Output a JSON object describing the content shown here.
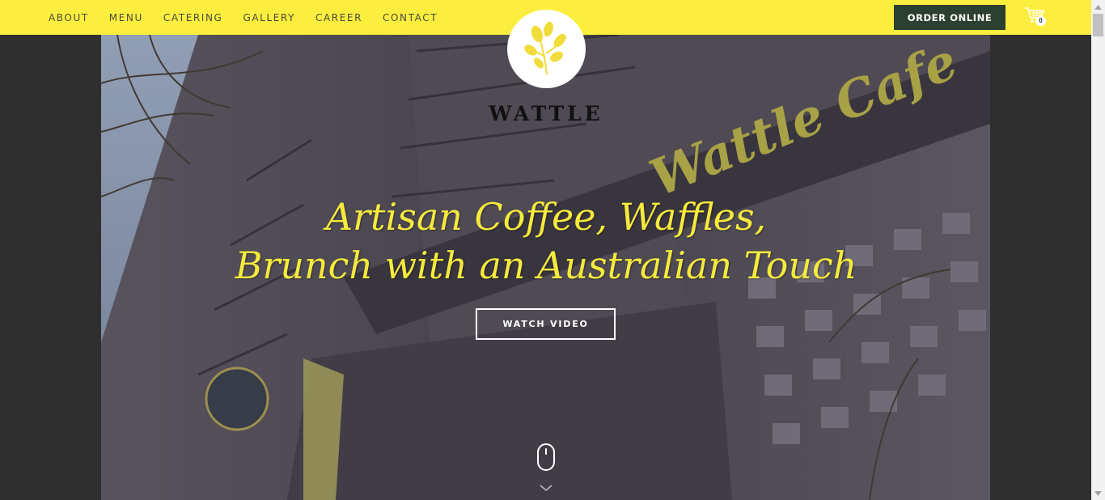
{
  "nav": {
    "items": [
      {
        "label": "ABOUT"
      },
      {
        "label": "MENU"
      },
      {
        "label": "CATERING"
      },
      {
        "label": "GALLERY"
      },
      {
        "label": "CAREER"
      },
      {
        "label": "CONTACT"
      }
    ],
    "order_label": "ORDER ONLINE",
    "cart_count": "0",
    "cart_icon": "shopping-cart-icon"
  },
  "brand": {
    "name": "WATTLE",
    "logo_icon": "wattle-flower-icon"
  },
  "hero": {
    "headline_line1": "Artisan Coffee, Waffles,",
    "headline_line2": "Brunch with an Australian Touch",
    "watch_label": "WATCH VIDEO",
    "scroll_icon": "mouse-scroll-icon",
    "signage_text": "Wattle Cafe"
  },
  "colors": {
    "topbar": "#fbee3e",
    "order_button": "#2b4030",
    "headline": "#f6ea3c",
    "background": "#2f2f2f"
  }
}
